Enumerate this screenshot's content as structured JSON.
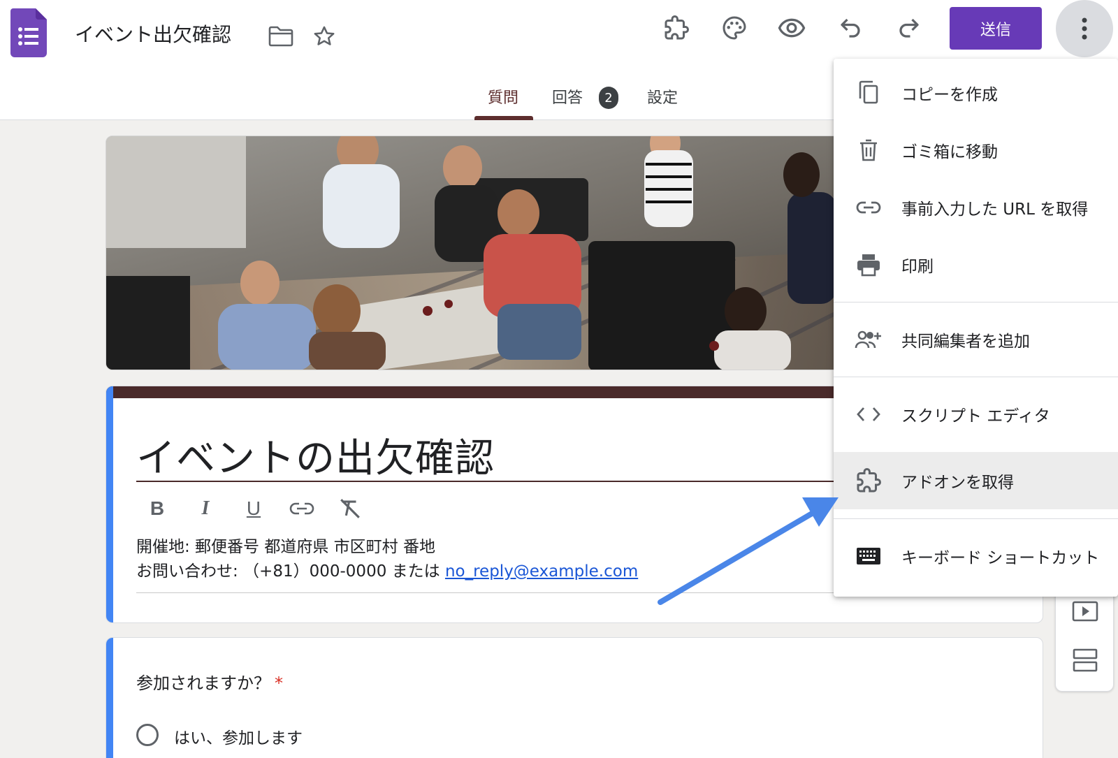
{
  "header": {
    "doc_title": "イベント出欠確認",
    "send_label": "送信",
    "icons": [
      "forms-logo-icon",
      "folder-icon",
      "star-icon",
      "addon-puzzle-icon",
      "palette-icon",
      "preview-eye-icon",
      "undo-icon",
      "redo-icon",
      "more-vert-icon"
    ]
  },
  "tabs": [
    {
      "label": "質問",
      "active": true
    },
    {
      "label": "回答",
      "badge": "2"
    },
    {
      "label": "設定"
    }
  ],
  "form": {
    "title": "イベントの出欠確認",
    "description_line1": "開催地: 郵便番号 都道府県 市区町村 番地",
    "description_line2_prefix": "お問い合わせ: （+81）000-0000 または ",
    "contact_email": "no_reply@example.com",
    "format_tools": [
      "bold-icon",
      "italic-icon",
      "underline-icon",
      "link-icon",
      "clear-format-icon"
    ]
  },
  "question": {
    "title": "参加されますか？",
    "required_mark": "*",
    "options": [
      "はい、参加します"
    ]
  },
  "menu": {
    "items": [
      {
        "label": "コピーを作成",
        "icon": "copy-icon"
      },
      {
        "label": "ゴミ箱に移動",
        "icon": "trash-icon"
      },
      {
        "label": "事前入力した URL を取得",
        "icon": "link-icon"
      },
      {
        "label": "印刷",
        "icon": "print-icon"
      },
      {
        "label": "共同編集者を追加",
        "icon": "add-people-icon"
      },
      {
        "label": "スクリプト エディタ",
        "icon": "code-icon"
      },
      {
        "label": "アドオンを取得",
        "icon": "addon-puzzle-icon",
        "highlighted": true
      },
      {
        "label": "キーボード ショートカット",
        "icon": "keyboard-icon"
      }
    ]
  },
  "colors": {
    "brand_purple": "#673ab7",
    "theme_dark": "#4a2a2a",
    "accent_blue": "#4285f4",
    "arrow_blue": "#4a86e8"
  }
}
